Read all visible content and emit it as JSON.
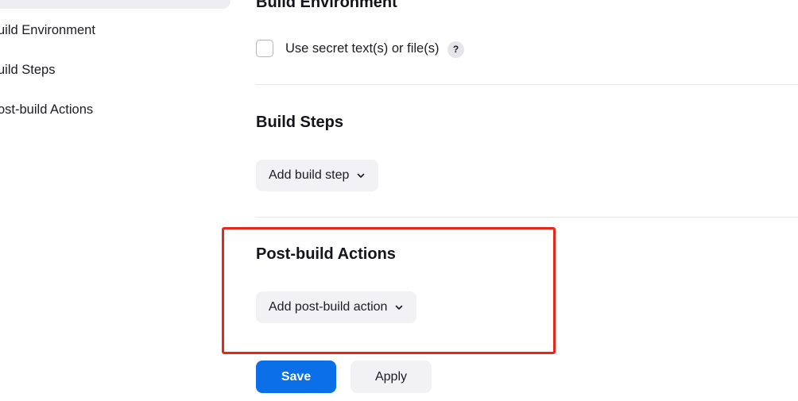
{
  "sidebar": {
    "items": [
      {
        "label": "Build Environment"
      },
      {
        "label": "Build Steps"
      },
      {
        "label": "Post-build Actions"
      }
    ]
  },
  "main": {
    "build_environment": {
      "title": "Build Environment",
      "checkbox_label": "Use secret text(s) or file(s)",
      "checkbox_checked": false,
      "help_label": "?"
    },
    "build_steps": {
      "title": "Build Steps",
      "add_button_label": "Add build step"
    },
    "post_build_actions": {
      "title": "Post-build Actions",
      "add_button_label": "Add post-build action"
    }
  },
  "footer": {
    "save_label": "Save",
    "apply_label": "Apply"
  },
  "colors": {
    "primary": "#0b6fe8",
    "highlight": "#e7271c",
    "button_bg": "#f2f2f5",
    "sidebar_active_bg": "#eeeef2"
  },
  "icons": {
    "help": "question-circle-icon",
    "dropdown": "chevron-down-icon"
  }
}
